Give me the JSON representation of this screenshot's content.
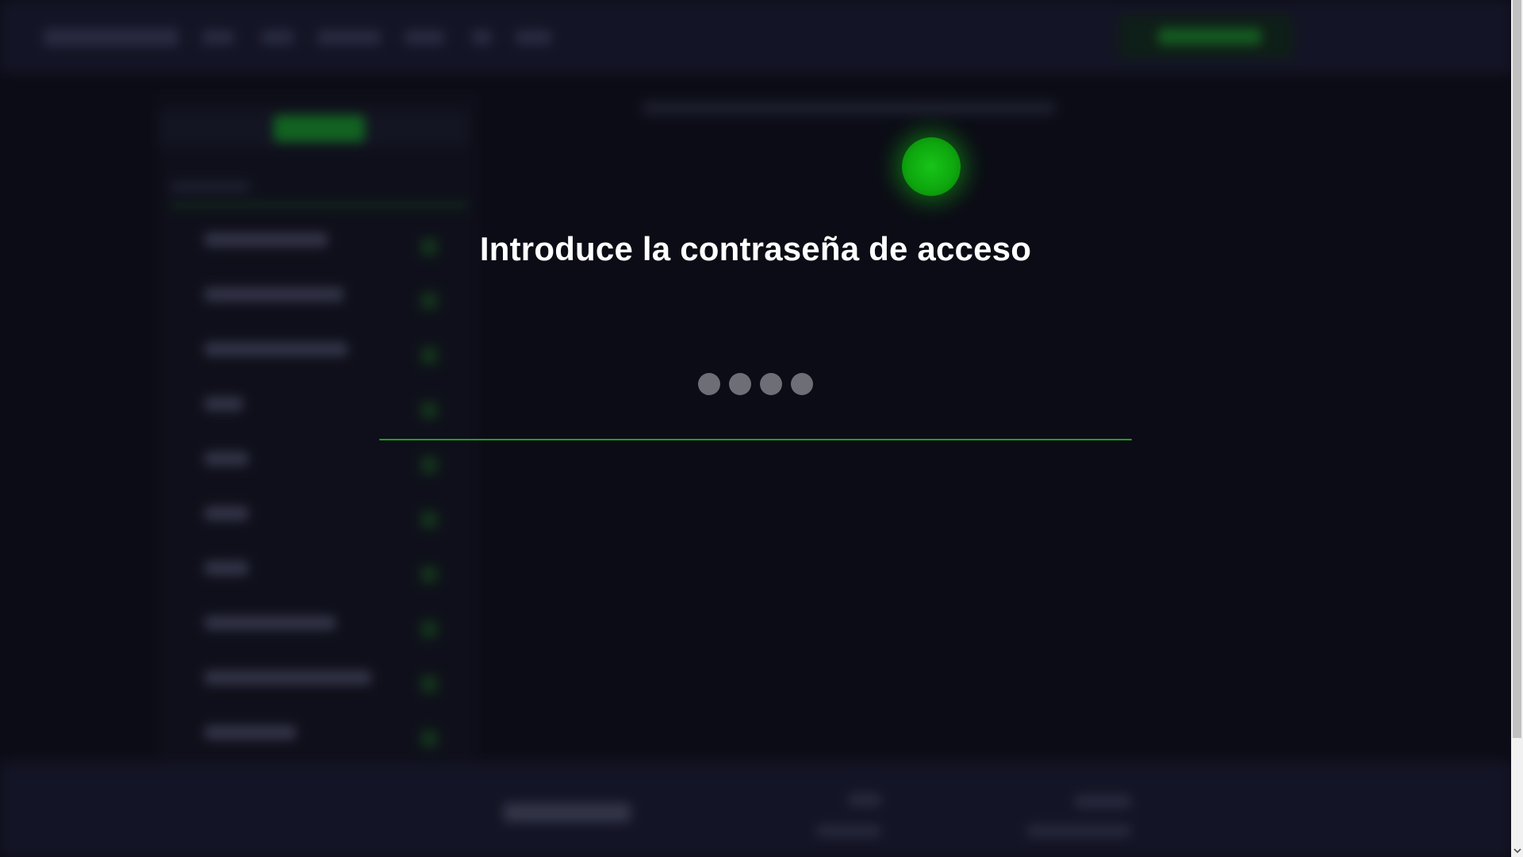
{
  "prompt": {
    "title": "Introduce la contraseña de acceso",
    "pin_length": 4,
    "entered_digits": 0
  },
  "colors": {
    "accent": "#16a516",
    "orb": "#0ea80e",
    "background": "#0e0f1a",
    "dot": "#6e6e76"
  },
  "icons": {
    "status": "status-orb-icon",
    "scroll_down": "chevron-down-icon"
  }
}
